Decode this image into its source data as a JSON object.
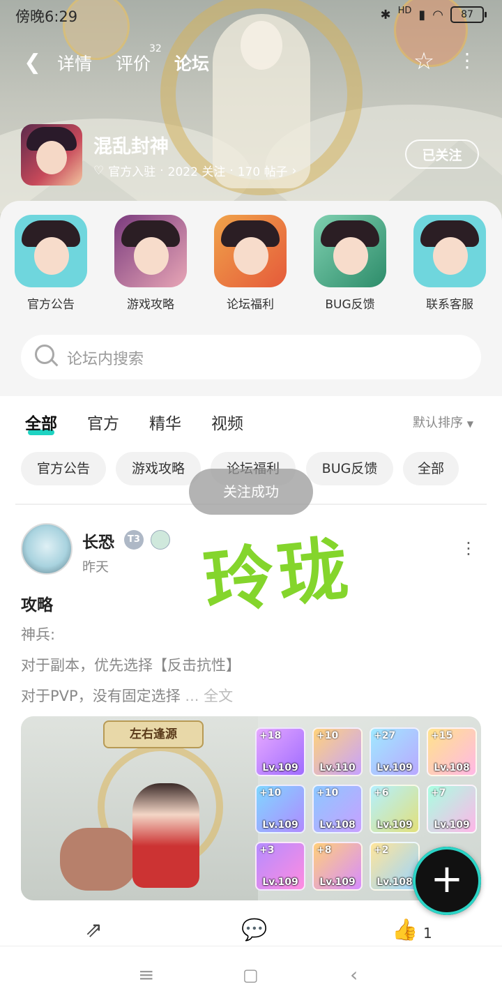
{
  "status_bar": {
    "time": "傍晚6:29",
    "network": "HD",
    "battery": "87"
  },
  "nav": {
    "tabs": [
      {
        "label": "详情"
      },
      {
        "label": "评价",
        "count": "32"
      },
      {
        "label": "论坛"
      }
    ]
  },
  "game": {
    "name": "混乱封神",
    "official": "官方入驻",
    "follows": "2022 关注",
    "posts": "170 帖子",
    "follow_button": "已关注"
  },
  "categories": [
    {
      "label": "官方公告"
    },
    {
      "label": "游戏攻略"
    },
    {
      "label": "论坛福利"
    },
    {
      "label": "BUG反馈"
    },
    {
      "label": "联系客服"
    }
  ],
  "search": {
    "placeholder": "论坛内搜索"
  },
  "filter_tabs": [
    "全部",
    "官方",
    "精华",
    "视频"
  ],
  "sort": "默认排序",
  "chips": [
    "官方公告",
    "游戏攻略",
    "论坛福利",
    "BUG反馈",
    "全部"
  ],
  "toast": "关注成功",
  "post": {
    "author": "长恐",
    "badge": "T3",
    "time": "昨天",
    "watermark": "玲珑",
    "title": "攻略",
    "lines": [
      "神兵:",
      "对于副本，优先选择【反击抗性】",
      "对于PVP，没有固定选择"
    ],
    "ellipsis": "...",
    "full_text": "全文",
    "image": {
      "banner": "左右逢源",
      "items": [
        {
          "plus": "+18",
          "lv": "Lv.109"
        },
        {
          "plus": "+10",
          "lv": "Lv.110"
        },
        {
          "plus": "+27",
          "lv": "Lv.109"
        },
        {
          "plus": "+15",
          "lv": "Lv.108"
        },
        {
          "plus": "+10",
          "lv": "Lv.109"
        },
        {
          "plus": "+10",
          "lv": "Lv.108"
        },
        {
          "plus": "+6",
          "lv": "Lv.109"
        },
        {
          "plus": "+7",
          "lv": "Lv.109"
        },
        {
          "plus": "+3",
          "lv": "Lv.109"
        },
        {
          "plus": "+8",
          "lv": "Lv.109"
        },
        {
          "plus": "+2",
          "lv": "Lv.108"
        }
      ]
    },
    "likes": "1"
  },
  "colors": {
    "accent": "#1fd3c2",
    "watermark": "#7ed321"
  }
}
